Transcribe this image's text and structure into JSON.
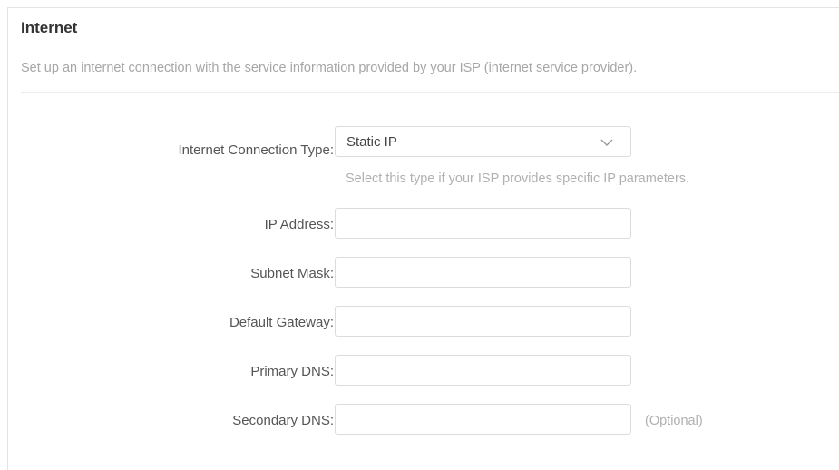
{
  "section": {
    "title": "Internet",
    "description": "Set up an internet connection with the service information provided by your ISP (internet service provider)."
  },
  "connection_type": {
    "label": "Internet Connection Type:",
    "selected": "Static IP",
    "hint": "Select this type if your ISP provides specific IP parameters."
  },
  "fields": {
    "ip_address": {
      "label": "IP Address:",
      "value": ""
    },
    "subnet_mask": {
      "label": "Subnet Mask:",
      "value": ""
    },
    "default_gateway": {
      "label": "Default Gateway:",
      "value": ""
    },
    "primary_dns": {
      "label": "Primary DNS:",
      "value": ""
    },
    "secondary_dns": {
      "label": "Secondary DNS:",
      "value": "",
      "note": "(Optional)"
    }
  },
  "icons": {
    "dropdown": "chevron-down-icon"
  }
}
